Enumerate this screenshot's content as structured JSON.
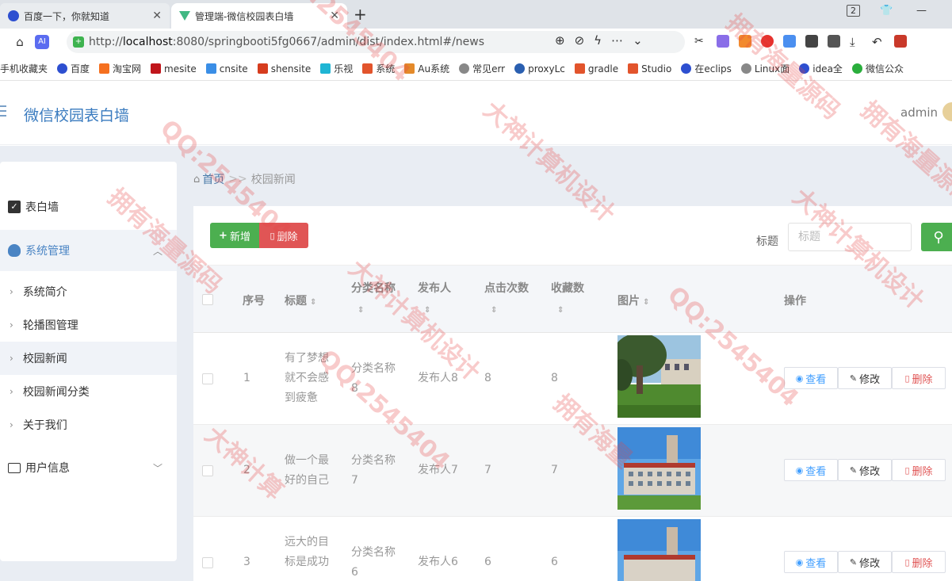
{
  "browser": {
    "tabs": [
      {
        "title": "百度一下，你就知道",
        "close": "✕"
      },
      {
        "title": "管理端-微信校园表白墙",
        "close": "✕"
      }
    ],
    "new_tab": "+",
    "window_badge": "2",
    "url_host": "localhost",
    "url_prefix": "http://",
    "url_rest": ":8080/springbooti5fg0667/admin/dist/index.html#/news",
    "bookmarks": [
      "手机收藏夹",
      "百度",
      "淘宝网",
      "mesite",
      "cnsite",
      "shensite",
      "乐视",
      "系统",
      "Au系统",
      "常见err",
      "proxyLc",
      "gradle",
      "Studio",
      "在eclips",
      "Linux面",
      "idea全",
      "微信公众"
    ]
  },
  "header": {
    "title": "微信校园表白墙",
    "user": "admin"
  },
  "sidebar": {
    "items": [
      {
        "label": "表白墙",
        "icon": "checkbox-icon"
      },
      {
        "label": "系统管理",
        "icon": "bulb-icon",
        "expanded": true
      },
      {
        "label": "系统简介"
      },
      {
        "label": "轮播图管理"
      },
      {
        "label": "校园新闻",
        "active": true
      },
      {
        "label": "校园新闻分类"
      },
      {
        "label": "关于我们"
      },
      {
        "label": "用户信息",
        "icon": "card-icon"
      }
    ]
  },
  "breadcrumb": {
    "home": "首页",
    "sep": ">>",
    "current": "校园新闻"
  },
  "toolbar": {
    "add": "新增",
    "delete": "删除",
    "search_label": "标题",
    "search_placeholder": "标题"
  },
  "table": {
    "headers": {
      "index": "序号",
      "title": "标题",
      "category": "分类名称",
      "publisher": "发布人",
      "clicks": "点击次数",
      "favorites": "收藏数",
      "image": "图片",
      "actions": "操作"
    },
    "rows": [
      {
        "index": "1",
        "title": [
          "有了梦想",
          "就不会感",
          "到疲惫"
        ],
        "category": [
          "分类名称",
          "8"
        ],
        "publisher": "发布人8",
        "clicks": "8",
        "favorites": "8"
      },
      {
        "index": "2",
        "title": [
          "做一个最",
          "好的自己"
        ],
        "category": [
          "分类名称",
          "7"
        ],
        "publisher": "发布人7",
        "clicks": "7",
        "favorites": "7"
      },
      {
        "index": "3",
        "title": [
          "远大的目",
          "标是成功"
        ],
        "category": [
          "分类名称",
          "6"
        ],
        "publisher": "发布人6",
        "clicks": "6",
        "favorites": "6"
      }
    ],
    "actions": {
      "view": "查看",
      "edit": "修改",
      "delete": "删除"
    }
  },
  "watermarks": [
    "QQ:2545404",
    "大神计算机设计",
    "拥有海量源码",
    "QQ:2545404",
    "大神计算机设计",
    "拥有海量源码",
    "QQ:2545404",
    "大神计算",
    "拥有海量",
    "QQ:2545404",
    "大神计算机设计",
    "拥有海量源码"
  ],
  "colors": {
    "primary_green": "#4caf50",
    "danger_red": "#e05555",
    "link_blue": "#409eff",
    "brand_blue": "#3a7bbf",
    "watermark": "#e64646"
  }
}
